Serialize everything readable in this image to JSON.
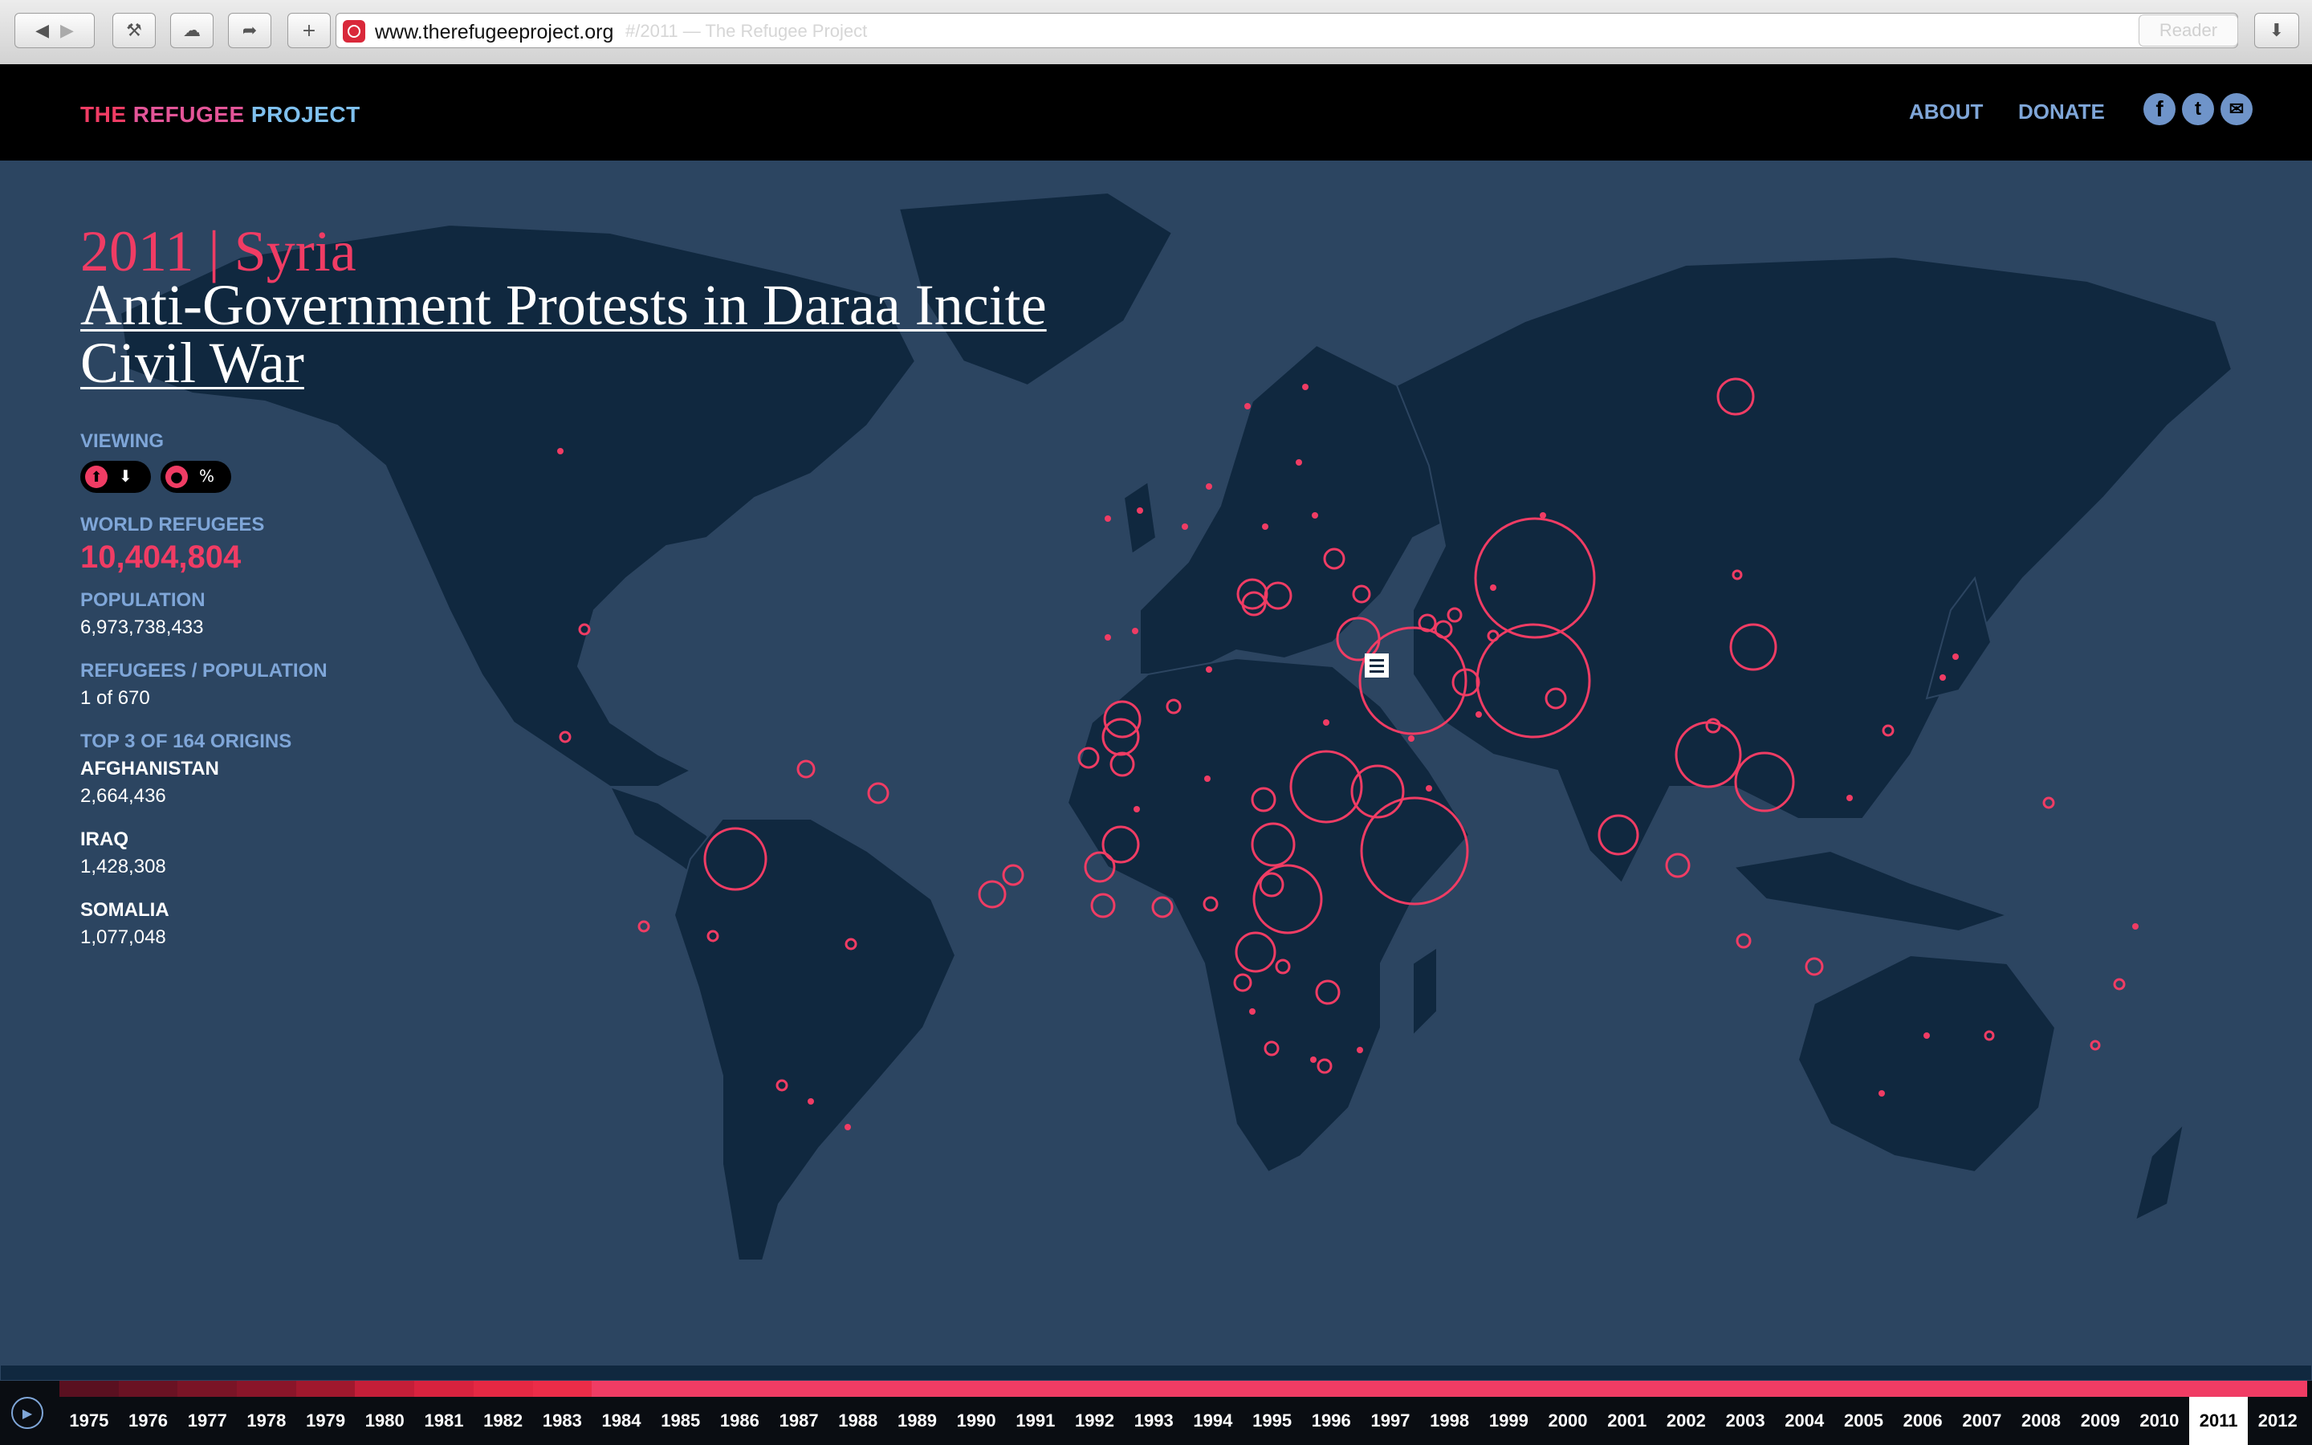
{
  "browser": {
    "url": "www.therefugeeproject.org",
    "tab_title_ghost": "#/2011 — The Refugee Project",
    "reader_label": "Reader",
    "icons": [
      "back-icon",
      "forward-icon",
      "bookmarks-icon",
      "cloud-icon",
      "share-icon",
      "new-tab-icon",
      "reload-icon",
      "download-icon"
    ]
  },
  "header": {
    "logo": [
      "THE ",
      "REFUGEE ",
      "PROJECT"
    ],
    "nav": [
      "ABOUT",
      "DONATE"
    ],
    "social": [
      "facebook-icon",
      "twitter-icon",
      "email-icon"
    ]
  },
  "event": {
    "year_country": "2011 | Syria",
    "title": "Anti-Government Protests in Daraa Incite Civil War"
  },
  "stats": {
    "viewing_label": "VIEWING",
    "world_refugees_label": "WORLD REFUGEES",
    "world_refugees": "10,404,804",
    "population_label": "POPULATION",
    "population": "6,973,738,433",
    "ratio_label": "REFUGEES / POPULATION",
    "ratio": "1 of 670",
    "top_label": "TOP 3 OF 164 ORIGINS",
    "top_origins": [
      {
        "name": "AFGHANISTAN",
        "value": "2,664,436"
      },
      {
        "name": "IRAQ",
        "value": "1,428,308"
      },
      {
        "name": "SOMALIA",
        "value": "1,077,048"
      }
    ]
  },
  "timeline": {
    "years": [
      "1975",
      "1976",
      "1977",
      "1978",
      "1979",
      "1980",
      "1981",
      "1982",
      "1983",
      "1984",
      "1985",
      "1986",
      "1987",
      "1988",
      "1989",
      "1990",
      "1991",
      "1992",
      "1993",
      "1994",
      "1995",
      "1996",
      "1997",
      "1998",
      "1999",
      "2000",
      "2001",
      "2002",
      "2003",
      "2004",
      "2005",
      "2006",
      "2007",
      "2008",
      "2009",
      "2010",
      "2011",
      "2012"
    ],
    "selected": "2011"
  },
  "colors": {
    "accent": "#f03c64",
    "ocean": "#2c4561",
    "land": "#10283f",
    "nav_text": "#7fa6d8"
  }
}
